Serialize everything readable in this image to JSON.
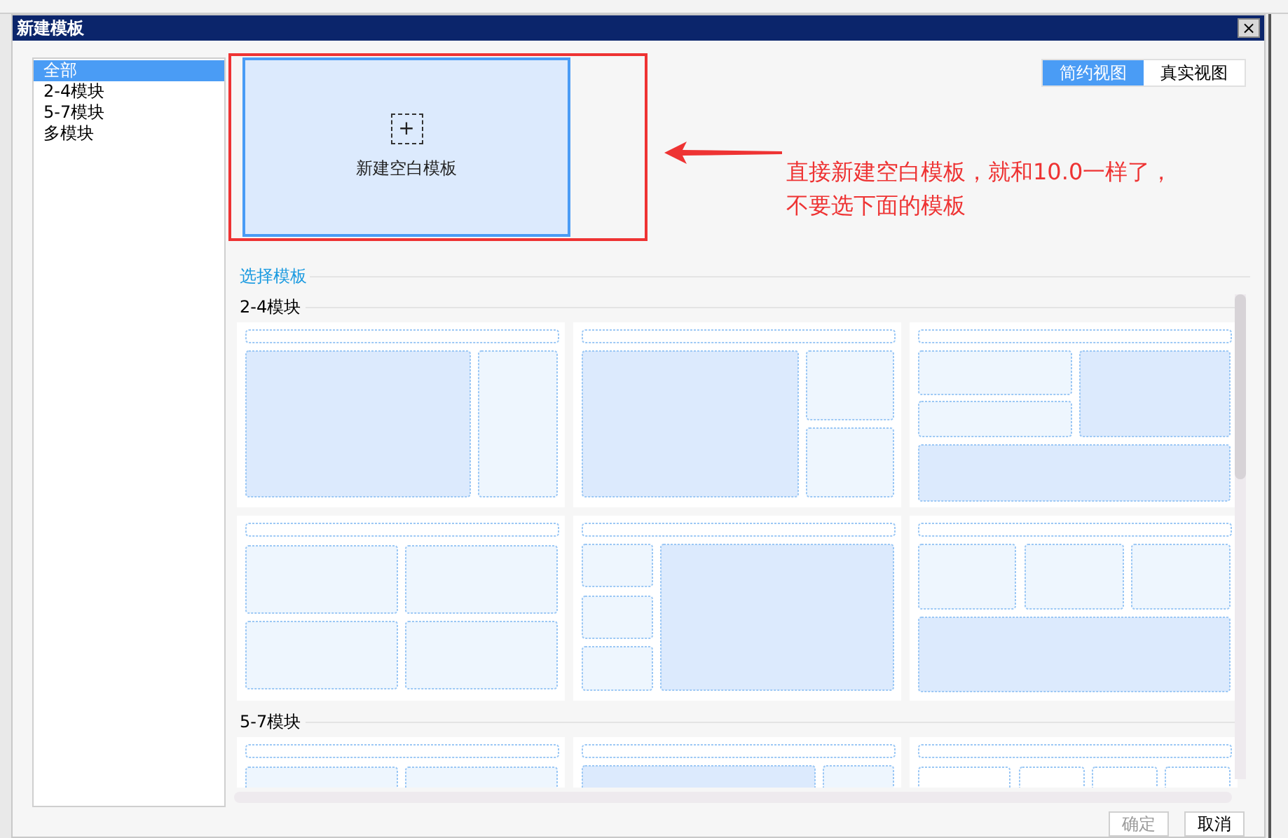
{
  "window": {
    "title": "新建模板",
    "close": "×"
  },
  "categories": [
    {
      "label": "全部",
      "selected": true
    },
    {
      "label": "2-4模块",
      "selected": false
    },
    {
      "label": "5-7模块",
      "selected": false
    },
    {
      "label": "多模块",
      "selected": false
    }
  ],
  "new_blank": {
    "icon": "+",
    "label": "新建空白模板"
  },
  "view_toggle": [
    {
      "label": "简约视图",
      "selected": true
    },
    {
      "label": "真实视图",
      "selected": false
    }
  ],
  "annotation": {
    "lines": [
      "直接新建空白模板，就和10.0一样了，",
      "不要选下面的模板"
    ]
  },
  "section_title": "选择模板",
  "groups": [
    {
      "title": "2-4模块",
      "templates": [
        {
          "kind": "a"
        },
        {
          "kind": "b"
        },
        {
          "kind": "c"
        },
        {
          "kind": "d"
        },
        {
          "kind": "e"
        },
        {
          "kind": "f"
        }
      ]
    },
    {
      "title": "5-7模块",
      "templates": [
        {
          "kind": "g"
        },
        {
          "kind": "h"
        },
        {
          "kind": "i"
        }
      ]
    }
  ],
  "buttons": [
    {
      "label": "确定",
      "disabled": true
    },
    {
      "label": "取消",
      "disabled": false
    }
  ]
}
